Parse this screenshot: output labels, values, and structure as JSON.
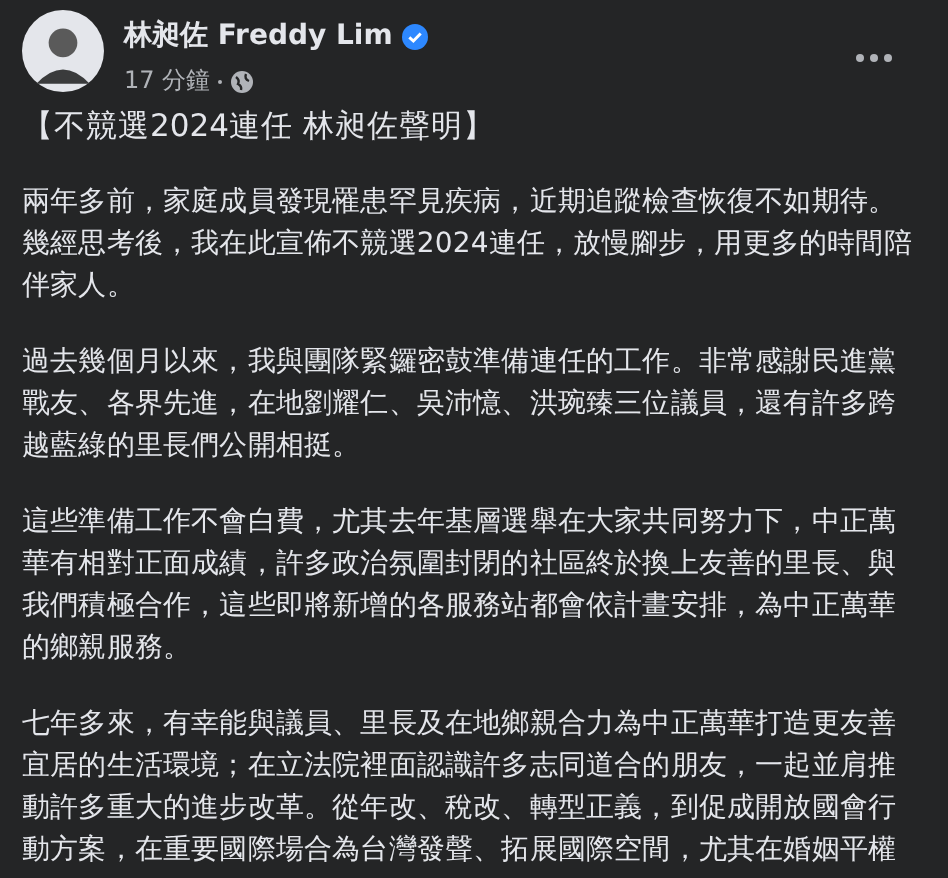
{
  "post": {
    "author": "林昶佐 Freddy Lim",
    "verified": true,
    "time": "17 分鐘",
    "title": "【不競選2024連任 林昶佐聲明】",
    "paragraphs": [
      {
        "lines": [
          "兩年多前，家庭成員發現罹患罕見疾病，近期追蹤檢查恢復不如期待。",
          "幾經思考後，我在此宣佈不競選2024連任，放慢腳步，用更多的時間陪",
          "伴家人。"
        ]
      },
      {
        "lines": [
          "過去幾個月以來，我與團隊緊鑼密鼓準備連任的工作。非常感謝民進黨",
          "戰友、各界先進，在地劉耀仁、吳沛憶、洪琬臻三位議員，還有許多跨",
          "越藍綠的里長們公開相挺。"
        ]
      },
      {
        "lines": [
          "這些準備工作不會白費，尤其去年基層選舉在大家共同努力下，中正萬",
          "華有相對正面成績，許多政治氛圍封閉的社區終於換上友善的里長、與",
          "我們積極合作，這些即將新增的各服務站都會依計畫安排，為中正萬華",
          "的鄉親服務。"
        ]
      },
      {
        "lines": [
          "七年多來，有幸能與議員、里長及在地鄉親合力為中正萬華打造更友善",
          "宜居的生活環境；在立法院裡面認識許多志同道合的朋友，一起並肩推",
          "動許多重大的進步改革。從年改、稅改、轉型正義，到促成開放國會行",
          "動方案，在重要國際場合為台灣發聲、拓展國際空間，尤其在婚姻平權"
        ]
      }
    ]
  }
}
